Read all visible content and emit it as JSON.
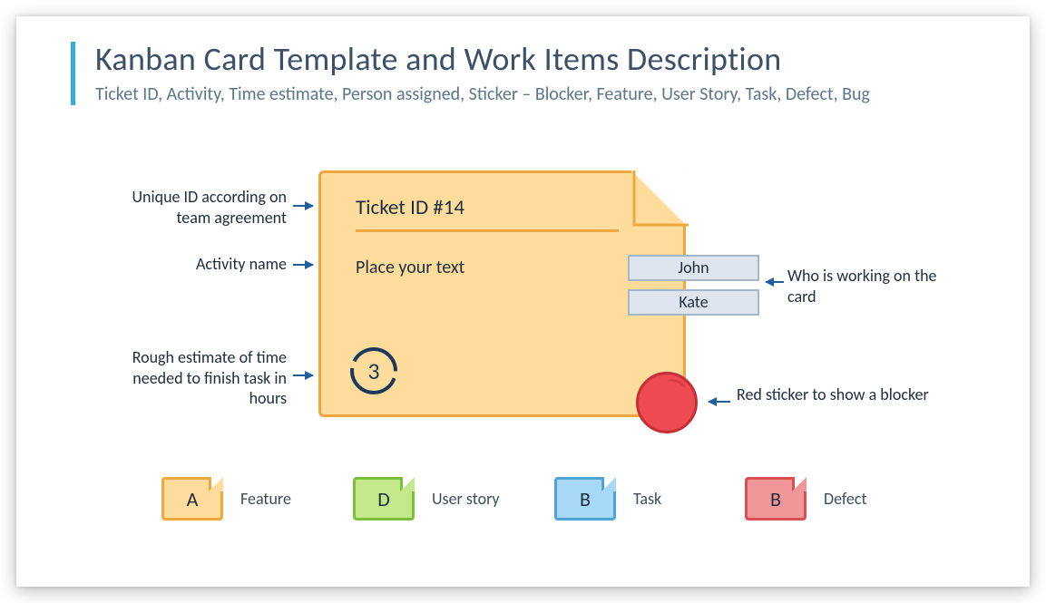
{
  "header": {
    "title": "Kanban Card Template and Work Items Description",
    "subtitle": "Ticket ID, Activity, Time estimate, Person assigned, Sticker – Blocker, Feature, User Story, Task, Defect, Bug"
  },
  "card": {
    "ticket_id": "Ticket ID #14",
    "body_text": "Place your text",
    "estimate": "3"
  },
  "assignees": [
    "John",
    "Kate"
  ],
  "annotations": {
    "id": "Unique ID according on team agreement",
    "activity": "Activity name",
    "estimate": "Rough estimate of time needed to finish task in hours",
    "who": "Who is working on the card",
    "blocker": "Red sticker to show a blocker"
  },
  "legend": [
    {
      "letter": "A",
      "label": "Feature",
      "bg": "#fddc9c",
      "border": "#f0a83e"
    },
    {
      "letter": "D",
      "label": "User story",
      "bg": "#c4e98c",
      "border": "#7cbf3a"
    },
    {
      "letter": "B",
      "label": "Task",
      "bg": "#a8d8f7",
      "border": "#4ea3d8"
    },
    {
      "letter": "B",
      "label": "Defect",
      "bg": "#f09699",
      "border": "#d84e53"
    }
  ],
  "colors": {
    "accent": "#2fb0d8",
    "text_dark": "#1f2d3d",
    "arrow": "#1f5d9c"
  }
}
